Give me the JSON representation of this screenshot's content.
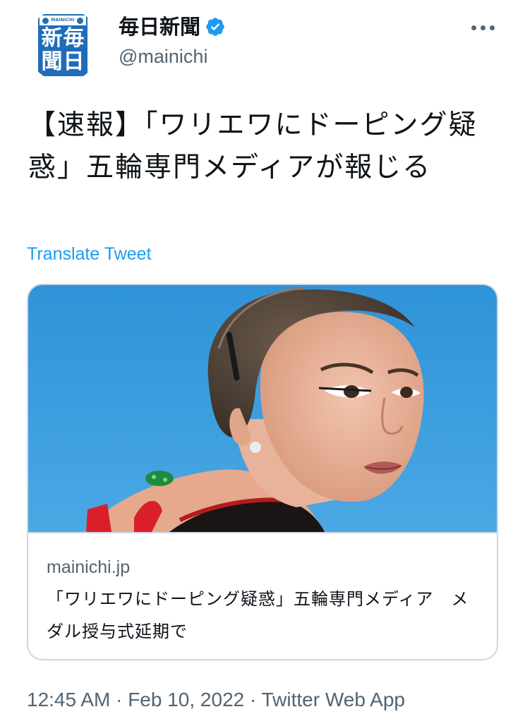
{
  "author": {
    "display_name": "毎日新聞",
    "handle": "@mainichi",
    "verified_icon": "verified-badge-icon",
    "avatar": {
      "top_label": "MAINICHI",
      "chars": [
        "新",
        "毎",
        "聞",
        "日"
      ]
    }
  },
  "tweet": {
    "text": "【速報】「ワリエワにドーピング疑惑」五輪専門メディアが報じる",
    "translate_label": "Translate Tweet"
  },
  "card": {
    "domain": "mainichi.jp",
    "title": "「ワリエワにドーピング疑惑」五輪専門メディア　メダル授与式延期で"
  },
  "meta": {
    "time": "12:45 AM",
    "date": "Feb 10, 2022",
    "source": "Twitter Web App",
    "separator": "·"
  },
  "colors": {
    "link": "#1d9bf0",
    "secondary_text": "#536471",
    "verified": "#1d9bf0",
    "logo_blue": "#1f6db8"
  }
}
